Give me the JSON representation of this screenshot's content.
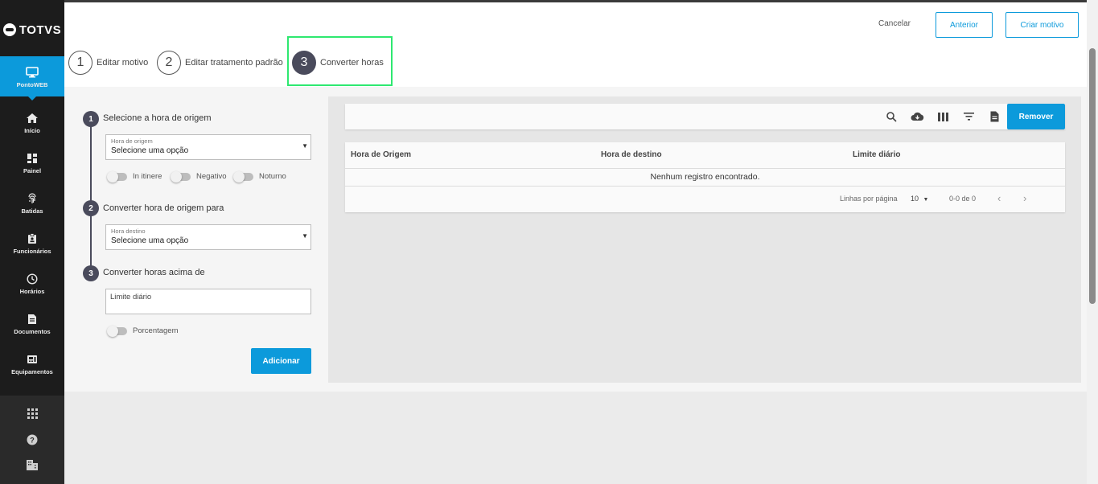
{
  "brand": {
    "logo_text": "TOTVS"
  },
  "sidebar": {
    "active": {
      "label": "PontoWEB",
      "icon": "monitor-icon"
    },
    "items": [
      {
        "label": "Início",
        "icon": "home-icon"
      },
      {
        "label": "Painel",
        "icon": "dashboard-icon"
      },
      {
        "label": "Batidas",
        "icon": "fingerprint-icon"
      },
      {
        "label": "Funcionários",
        "icon": "badge-icon"
      },
      {
        "label": "Horários",
        "icon": "clock-icon"
      },
      {
        "label": "Documentos",
        "icon": "document-icon"
      },
      {
        "label": "Equipamentos",
        "icon": "device-icon"
      }
    ],
    "lower_icons": [
      "apps-grid-icon",
      "help-icon",
      "building-icon"
    ]
  },
  "header": {
    "cancel_label": "Cancelar",
    "previous_label": "Anterior",
    "create_label": "Criar motivo"
  },
  "stepper": {
    "steps": [
      {
        "number": "1",
        "label": "Editar motivo"
      },
      {
        "number": "2",
        "label": "Editar tratamento padrão"
      },
      {
        "number": "3",
        "label": "Converter horas"
      }
    ],
    "active_index": 2
  },
  "form": {
    "step1": {
      "number": "1",
      "title": "Selecione a hora de origem",
      "field_label": "Hora de origem",
      "value": "Selecione uma opção"
    },
    "toggles1": [
      {
        "label": "In itinere",
        "on": false
      },
      {
        "label": "Negativo",
        "on": false
      },
      {
        "label": "Noturno",
        "on": false
      }
    ],
    "step2": {
      "number": "2",
      "title": "Converter hora de origem para",
      "field_label": "Hora destino",
      "value": "Selecione uma opção"
    },
    "step3": {
      "number": "3",
      "title": "Converter horas acima de",
      "placeholder": "Limite diário"
    },
    "toggle_percent": {
      "label": "Porcentagem",
      "on": false
    },
    "add_label": "Adicionar"
  },
  "table": {
    "toolbar_icons": [
      "search-icon",
      "cloud-download-icon",
      "columns-icon",
      "filter-icon",
      "file-icon"
    ],
    "remove_label": "Remover",
    "columns": [
      "Hora de Origem",
      "Hora de destino",
      "Limite diário"
    ],
    "empty_message": "Nenhum registro encontrado.",
    "footer": {
      "rows_per_page_label": "Linhas por página",
      "rows_per_page_value": "10",
      "range": "0-0 de 0"
    }
  },
  "colors": {
    "accent": "#0c9adb",
    "sidebar": "#1c1c1c",
    "step_active": "#4a4b5c",
    "highlight": "#2ee870"
  }
}
